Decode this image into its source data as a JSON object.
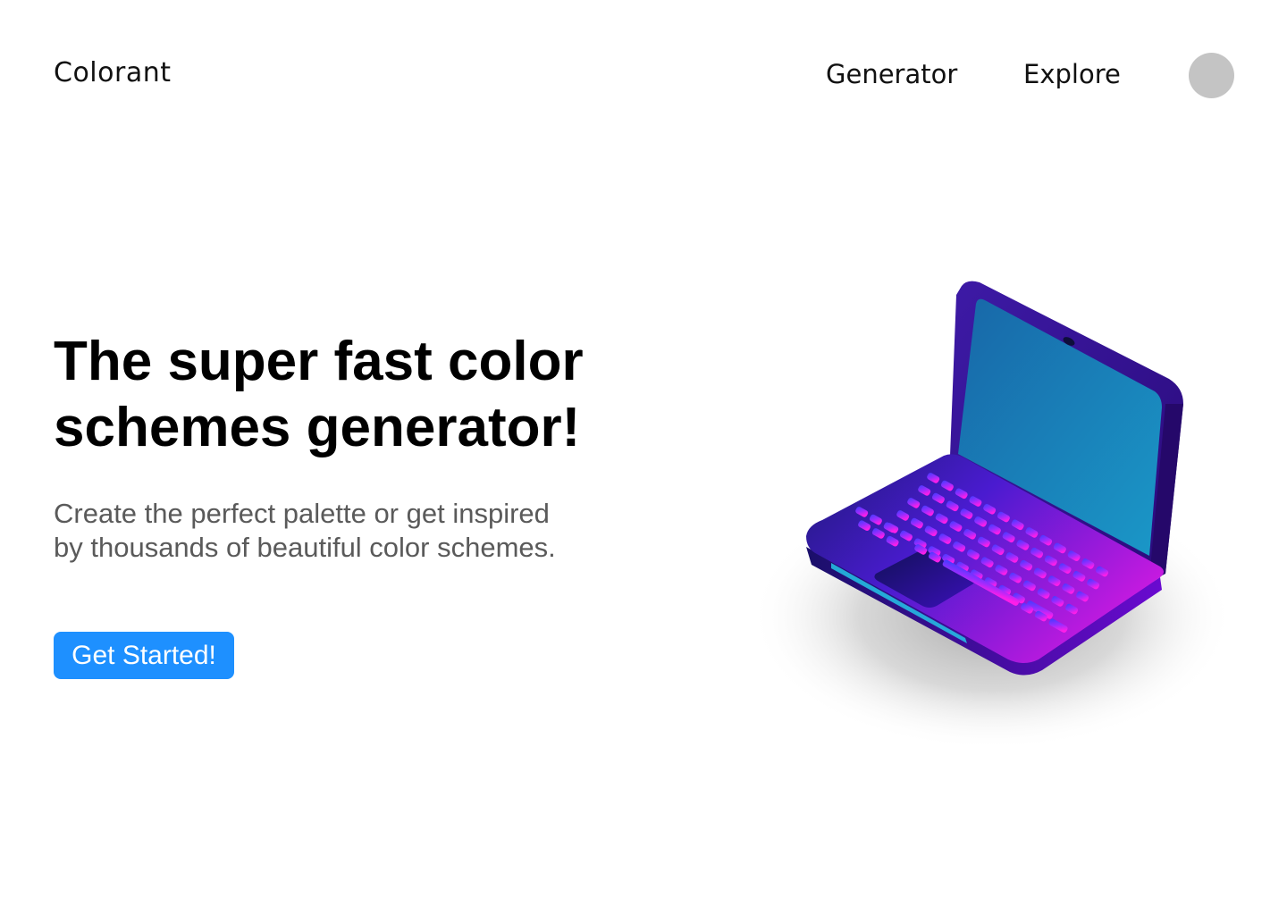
{
  "header": {
    "logo": "Colorant",
    "nav": [
      {
        "label": "Generator"
      },
      {
        "label": "Explore"
      }
    ]
  },
  "hero": {
    "title": "The super fast color schemes generator!",
    "subtitle": "Create the perfect palette or get inspired by thousands of beautiful color schemes.",
    "cta_label": "Get Started!"
  },
  "colors": {
    "accent": "#1e90ff",
    "avatar": "#c4c4c4",
    "laptop_body": "#3a0ca3",
    "laptop_screen": "#1a8cc4",
    "keys_glow": "#ff00e0"
  },
  "icons": {
    "avatar": "user-avatar-placeholder",
    "illustration": "isometric-laptop-illustration"
  }
}
